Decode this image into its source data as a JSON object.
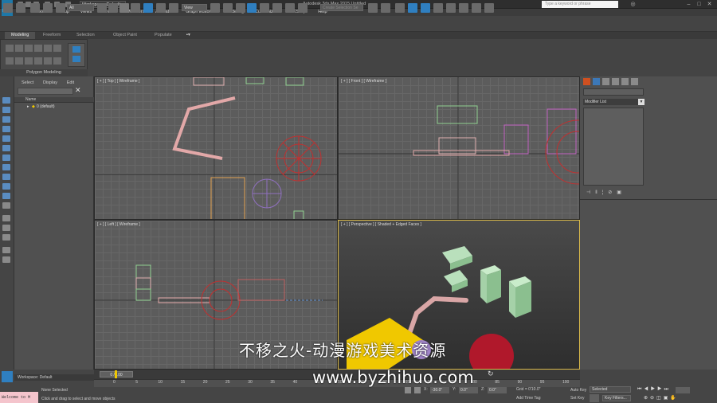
{
  "titlebar": {
    "app_logo": "MAX",
    "workspace": "Workspace: Default",
    "title": "Autodesk 3ds Max 2015     Untitled",
    "search_placeholder": "Type a keyword or phrase"
  },
  "menu": [
    "Edit",
    "Tools",
    "Group",
    "Views",
    "Create",
    "Modifiers",
    "Animation",
    "Graph Editors",
    "Rendering",
    "Customize",
    "MAXScript",
    "Help"
  ],
  "toolbar": {
    "selection_filter": "All",
    "view_select": "View",
    "named_set_placeholder": "Create Selection Se"
  },
  "ribbon": {
    "tabs": [
      "Modeling",
      "Freeform",
      "Selection",
      "Object Paint",
      "Populate"
    ],
    "panel_label": "Polygon Modeling"
  },
  "scene_explorer": {
    "tabs": [
      "Select",
      "Display",
      "Edit"
    ],
    "column_name": "Name",
    "row": "0 (default)"
  },
  "viewports": {
    "top": "[ + ] [ Top ] [ Wireframe ]",
    "front": "[ + ] [ Front ] [ Wireframe ]",
    "left": "[ + ] [ Left ] [ Wireframe ]",
    "perspective": "[ + ] [ Perspective ] [ Shaded + Edged Faces ]"
  },
  "command_panel": {
    "modifier_list": "Modifier List"
  },
  "timeline": {
    "slider": "0 / 100",
    "ticks": [
      "0",
      "5",
      "10",
      "15",
      "20",
      "25",
      "30",
      "35",
      "40",
      "45",
      "50",
      "55",
      "60",
      "65",
      "70",
      "75",
      "80",
      "85",
      "90",
      "95",
      "100"
    ]
  },
  "status": {
    "workspace": "Workspace: Default",
    "listener": "Welcome to M",
    "selection": "None Selected",
    "prompt": "Click and drag to select and move objects",
    "x": "X:",
    "y": "Y:",
    "z": "Z:",
    "x_val": "-30.0\"",
    "y_val": "0.0\"",
    "z_val": "0.0\"",
    "grid": "Grid = 0'10.0\"",
    "add_time_tag": "Add Time Tag",
    "auto_key": "Auto Key",
    "auto_key_mode": "Selected",
    "set_key": "Set Key",
    "key_filters": "Key Filters..."
  },
  "watermark": {
    "line1": "不移之火-动漫游戏美术资源",
    "line2": "www.byzhihuo.com"
  },
  "colors": {
    "accent": "#1e78a8",
    "selection": "#f0c800"
  }
}
